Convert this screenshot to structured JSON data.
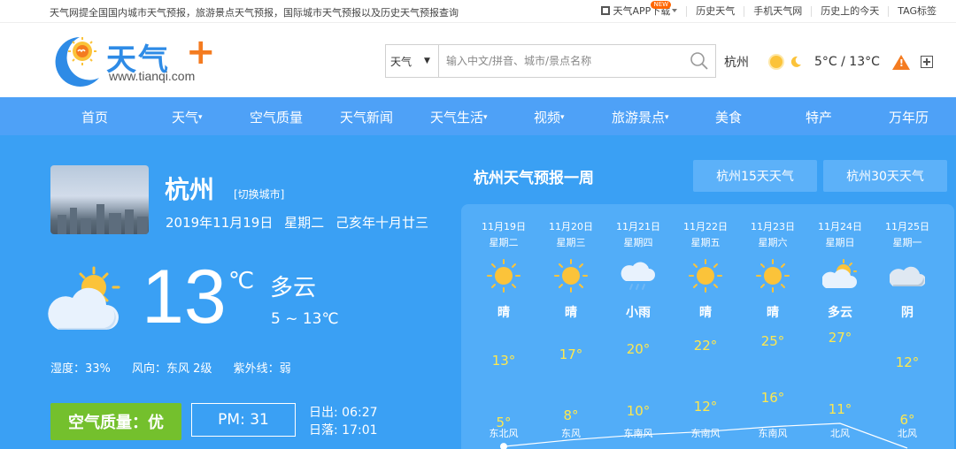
{
  "topbar": {
    "intro": "天气网提全国国内城市天气预报，旅游景点天气预报，国际城市天气预报以及历史天气预报查询",
    "app_download": "天气APP下载",
    "new_badge": "NEW",
    "links": [
      "历史天气",
      "手机天气网",
      "历史上的今天",
      "TAG标签"
    ]
  },
  "header": {
    "logo_text": "天气",
    "logo_plus": "+",
    "logo_url": "www.tianqi.com",
    "search_type": "天气",
    "search_placeholder": "输入中文/拼音、城市/景点名称",
    "current_city": "杭州",
    "temp_range": "5°C / 13°C",
    "warn_glyph": "!",
    "icons": [
      "search-icon",
      "sun-icon",
      "moon-icon",
      "warning-icon",
      "add-icon"
    ]
  },
  "nav": [
    {
      "label": "首页",
      "caret": ""
    },
    {
      "label": "天气",
      "caret": "▾"
    },
    {
      "label": "空气质量",
      "caret": ""
    },
    {
      "label": "天气新闻",
      "caret": ""
    },
    {
      "label": "天气生活",
      "caret": "▾"
    },
    {
      "label": "视频",
      "caret": "▾"
    },
    {
      "label": "旅游景点",
      "caret": "▾"
    },
    {
      "label": "美食",
      "caret": ""
    },
    {
      "label": "特产",
      "caret": ""
    },
    {
      "label": "万年历",
      "caret": ""
    }
  ],
  "current": {
    "city": "杭州",
    "switch_city": "[切换城市]",
    "date": "2019年11月19日",
    "weekday": "星期二",
    "lunar": "己亥年十月廿三",
    "temp": "13",
    "unit": "℃",
    "condition": "多云",
    "range": "5 ~ 13℃",
    "humidity": "湿度：33%",
    "wind": "风向：东风 2级",
    "uv": "紫外线：弱",
    "air_quality": "空气质量：优",
    "pm": "PM: 31",
    "sunrise": "日出: 06:27",
    "sunset": "日落: 17:01"
  },
  "week": {
    "title": "杭州天气预报一周",
    "btn15": "杭州15天天气",
    "btn30": "杭州30天天气",
    "days": [
      {
        "date": "11月19日",
        "weekday": "星期二",
        "cond": "晴",
        "icon": "sun-icon",
        "hi": "13°",
        "lo": "5°",
        "wind": "东北风"
      },
      {
        "date": "11月20日",
        "weekday": "星期三",
        "cond": "晴",
        "icon": "sun-icon",
        "hi": "17°",
        "lo": "8°",
        "wind": "东风"
      },
      {
        "date": "11月21日",
        "weekday": "星期四",
        "cond": "小雨",
        "icon": "rain-cloud-icon",
        "hi": "20°",
        "lo": "10°",
        "wind": "东南风"
      },
      {
        "date": "11月22日",
        "weekday": "星期五",
        "cond": "晴",
        "icon": "sun-icon",
        "hi": "22°",
        "lo": "12°",
        "wind": "东南风"
      },
      {
        "date": "11月23日",
        "weekday": "星期六",
        "cond": "晴",
        "icon": "sun-icon",
        "hi": "25°",
        "lo": "16°",
        "wind": "东南风"
      },
      {
        "date": "11月24日",
        "weekday": "星期日",
        "cond": "多云",
        "icon": "partly-cloudy-icon",
        "hi": "27°",
        "lo": "11°",
        "wind": "北风"
      },
      {
        "date": "11月25日",
        "weekday": "星期一",
        "cond": "阴",
        "icon": "cloud-icon",
        "hi": "12°",
        "lo": "6°",
        "wind": "北风"
      }
    ],
    "series": {
      "hi": [
        13,
        17,
        20,
        22,
        25,
        27,
        12
      ],
      "lo": [
        5,
        8,
        10,
        12,
        16,
        11,
        6
      ]
    }
  },
  "colors": {
    "nav": "#4ea1f7",
    "main": "#3aa0f4",
    "panel": "#52adf8",
    "aq_good": "#74c02d",
    "temp_text": "#ffe84d",
    "accent": "#f47b20",
    "logo_blue": "#2e8be6"
  }
}
